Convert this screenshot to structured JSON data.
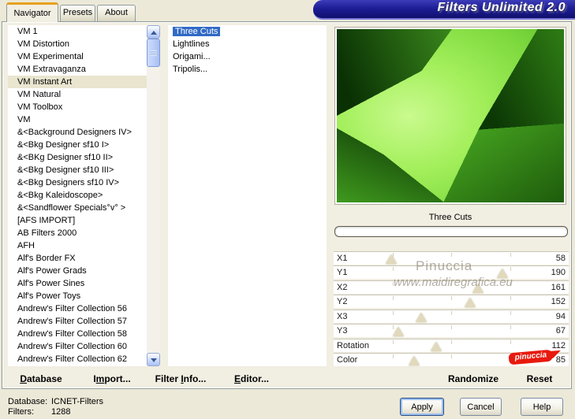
{
  "window": {
    "title": "Filters Unlimited 2.0"
  },
  "tabs": {
    "navigator": "Navigator",
    "presets": "Presets",
    "about": "About"
  },
  "collections": {
    "selected": "VM Instant Art",
    "items": [
      "VM 1",
      "VM Distortion",
      "VM Experimental",
      "VM Extravaganza",
      "VM Instant Art",
      "VM Natural",
      "VM Toolbox",
      "VM",
      "&<Background Designers IV>",
      "&<Bkg Designer sf10 I>",
      "&<BKg Designer sf10 II>",
      "&<Bkg Designer sf10 III>",
      "&<Bkg Designers sf10 IV>",
      "&<Bkg Kaleidoscope>",
      "&<Sandflower Specials°v° >",
      "[AFS IMPORT]",
      "AB Filters 2000",
      "AFH",
      "Alf's Border FX",
      "Alf's Power Grads",
      "Alf's Power Sines",
      "Alf's Power Toys",
      "Andrew's Filter Collection 56",
      "Andrew's Filter Collection 57",
      "Andrew's Filter Collection 58",
      "Andrew's Filter Collection 60",
      "Andrew's Filter Collection 62"
    ]
  },
  "filters": {
    "selected": "Three Cuts",
    "items": [
      "Three Cuts",
      "Lightlines",
      "Origami...",
      "Tripolis..."
    ]
  },
  "preview": {
    "caption": "Three Cuts"
  },
  "sliders": {
    "max": 255,
    "rows": [
      {
        "label": "X1",
        "value": 58
      },
      {
        "label": "Y1",
        "value": 190
      },
      {
        "label": "X2",
        "value": 161
      },
      {
        "label": "Y2",
        "value": 152
      },
      {
        "label": "X3",
        "value": 94
      },
      {
        "label": "Y3",
        "value": 67
      },
      {
        "label": "Rotation",
        "value": 112
      },
      {
        "label": "Color",
        "value": 85
      }
    ]
  },
  "actions": {
    "database": {
      "pre": "",
      "mn": "D",
      "post": "atabase"
    },
    "import": {
      "pre": "I",
      "mn": "m",
      "post": "port..."
    },
    "filter_info": {
      "pre": "Filter ",
      "mn": "I",
      "post": "nfo..."
    },
    "editor": {
      "pre": "",
      "mn": "E",
      "post": "ditor..."
    },
    "randomize": {
      "pre": "Randomize",
      "mn": "",
      "post": ""
    },
    "reset": {
      "pre": "Reset",
      "mn": "",
      "post": ""
    }
  },
  "watermarks": {
    "artist": "Pinuccia",
    "site": "www.maidiregrafica.eu",
    "stamp": "pinuccia"
  },
  "status": {
    "database_label": "Database:",
    "database_value": "ICNET-Filters",
    "filters_label": "Filters:",
    "filters_value": "1288"
  },
  "footer": {
    "apply": "Apply",
    "cancel": "Cancel",
    "help": "Help"
  },
  "colors": {
    "selection_blue": "#316ac5",
    "banner_navy": "#1d1d96",
    "stamp_red": "#e8190d",
    "preview_dark_green": "#0a3104",
    "preview_bright_green": "#a3ef5b",
    "dialog_beige": "#ece9d8"
  }
}
